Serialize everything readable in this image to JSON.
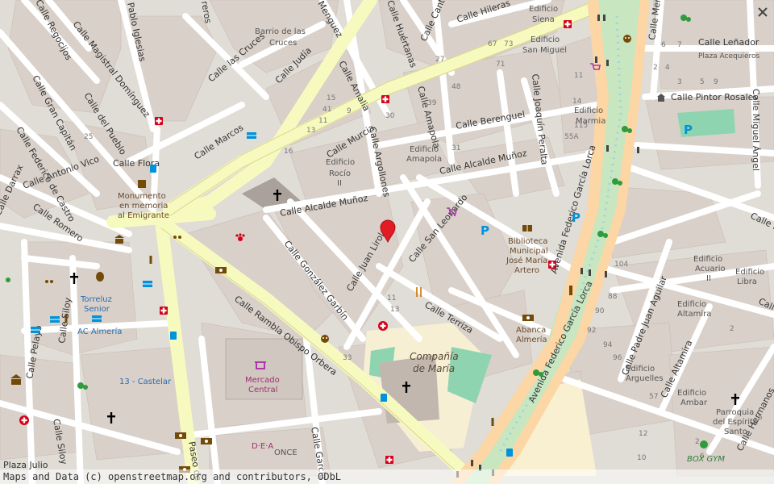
{
  "streets": {
    "rambla": "Calle Rambla Obispo Orbera",
    "alcalde1": "Calle Alcalde Muñoz",
    "alcalde2": "Calle Alcalde Muñoz",
    "murcia": "Calle Murcia",
    "marcos": "Calle Marcos",
    "flora": "Calle Flora",
    "antonio_vico": "Calle Antonio Vico",
    "romero": "Calle Romero",
    "fed_castro": "Calle Federico de Castro",
    "gran_capitan": "Calle Gran Capitán",
    "del_pueblo": "Calle del Pueblo",
    "magistral": "Calle Magistral Domínguez",
    "regocijos": "Calle Regocijos",
    "pablo_iglesias": "Pablo Iglesias",
    "las_cruces": "Calle las Cruces",
    "judia": "Calle Judía",
    "amalia": "Calle Amalia",
    "argollones": "Calle Argollones",
    "amapola": "Calle Amapola",
    "berenguel": "Calle Berenguel",
    "joaquin_peralta": "Calle Joaquín Peralta",
    "hileras": "Calle Hileras",
    "cantares": "Calle Cantares",
    "huertanas": "Calle Huértanas",
    "gonzalez_garbin": "Calle González Garbín",
    "juan_lirola": "Calle Juan Lirola",
    "san_leonardo": "Calle San Leonardo",
    "terriza": "Calle Terriza",
    "fgl1": "Avenida Federico García Lorca",
    "fgl2": "Avenida Federico García Lorca",
    "padre_juan": "Calle Padre Juan Aguilar",
    "altamira": "Calle Altamira",
    "miguel_angel": "Calle Miguel Ángel",
    "pintor": "Calle Pintor Rosales",
    "lenador": "Calle Leñador",
    "mercurio": "Calle Mercurio",
    "silloy1": "Calle Siloy",
    "silloy2": "Calle Siloy",
    "pelayo": "Calle Pelayo",
    "darrax": "Calle Darrax",
    "hermanos": "Calle Hermanos",
    "paseo": "Paseo de",
    "garcia": "Calle García",
    "plaza_julio": "Plaza Julio",
    "calle_d": "Calle D",
    "calle_m": "Calle M",
    "menguez": "Menguez",
    "calle_ros": "reros"
  },
  "places": {
    "barrio": [
      "Barrio de las",
      "Cruces"
    ],
    "monumento": [
      "Monumento",
      "en memoria",
      "al Emigrante"
    ],
    "edificio_rocio": [
      "Edificio",
      "Rocío",
      "II"
    ],
    "edificio_amapola": [
      "Edificio",
      "Amapola"
    ],
    "edificio_siena": [
      "Edificio",
      "Siena"
    ],
    "edificio_san_miguel": [
      "Edificio",
      "San Miguel"
    ],
    "edificio_marmia": [
      "Edificio",
      "Marmia"
    ],
    "biblioteca": [
      "Biblioteca",
      "Municipal",
      "José María",
      "Artero"
    ],
    "abanca": [
      "Abanca",
      "Almería"
    ],
    "compania": [
      "Compañía",
      "de María"
    ],
    "mercado": [
      "Mercado",
      "Central"
    ],
    "torreluz": [
      "Torreluz",
      "Senior"
    ],
    "ac_almeria": "AC Almería",
    "castelar": "13 - Castelar",
    "dea": "D·E·A",
    "once": "ONCE",
    "edificio_acuario": [
      "Edificio",
      "Acuario",
      "II"
    ],
    "edificio_libra": [
      "Edificio",
      "Libra"
    ],
    "edificio_altamira": [
      "Edificio",
      "Altamira"
    ],
    "edificio_arguelles": [
      "Edificio",
      "Arguelles"
    ],
    "edificio_ambar": [
      "Edificio",
      "Ambar"
    ],
    "parroquia": [
      "Parroquia",
      "del Espíritu",
      "Santo"
    ],
    "box_gym": "BOX GYM",
    "plaza_acequieros": "Plaza Acequieros"
  },
  "house_numbers": [
    "15",
    "41",
    "11",
    "13",
    "16",
    "25",
    "27",
    "30",
    "31",
    "39",
    "48",
    "67",
    "73",
    "71",
    "2",
    "4",
    "3",
    "5",
    "9",
    "6",
    "7",
    "14",
    "11",
    "115",
    "55A",
    "104",
    "92",
    "94",
    "96",
    "90",
    "88",
    "57",
    "33",
    "11",
    "13",
    "2",
    "6",
    "10",
    "12",
    "5",
    "2",
    "9"
  ],
  "attribution": "Maps and Data (c) openstreetmap.org and contributors, ODbL",
  "colors": {
    "land": "#e0dcd6",
    "building": "#d9d0c9",
    "road_minor": "#ffffff",
    "road_secondary": "#f7fabf",
    "road_primary": "#fcd6a4",
    "park": "#c8e6c0",
    "water": "#aad3df",
    "school": "#f8f0d0",
    "hospital_icon": "#d6001a",
    "marker": "#e31b23",
    "parking": "#0092da"
  }
}
